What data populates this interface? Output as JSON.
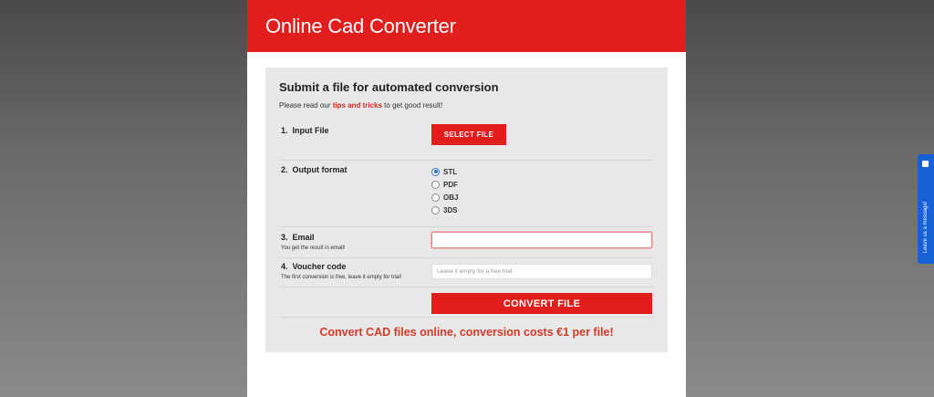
{
  "header": {
    "title": "Online Cad Converter"
  },
  "form": {
    "heading": "Submit a file for automated conversion",
    "intro_before": "Please read our ",
    "intro_link": "tips and tricks",
    "intro_after": " to get good result!",
    "input_file": {
      "number": "1.",
      "label": "Input File",
      "button": "SELECT FILE"
    },
    "output_format": {
      "number": "2.",
      "label": "Output format",
      "options": [
        "STL",
        "PDF",
        "OBJ",
        "3DS"
      ],
      "selected": "STL"
    },
    "email": {
      "number": "3.",
      "label": "Email",
      "hint": "You get the result in email!",
      "value": ""
    },
    "voucher": {
      "number": "4.",
      "label": "Voucher code",
      "hint": "The first conversion is free, leave it empty for trial!",
      "placeholder": "Leave it empty for a free trial"
    },
    "convert_button": "CONVERT FILE",
    "promo": "Convert CAD files online, conversion costs €1 per file!"
  },
  "chat": {
    "label": "Leave us a message!"
  },
  "colors": {
    "brand_red": "#e21d1d",
    "promo_red": "#d43a2a",
    "chat_blue": "#1760d6"
  }
}
